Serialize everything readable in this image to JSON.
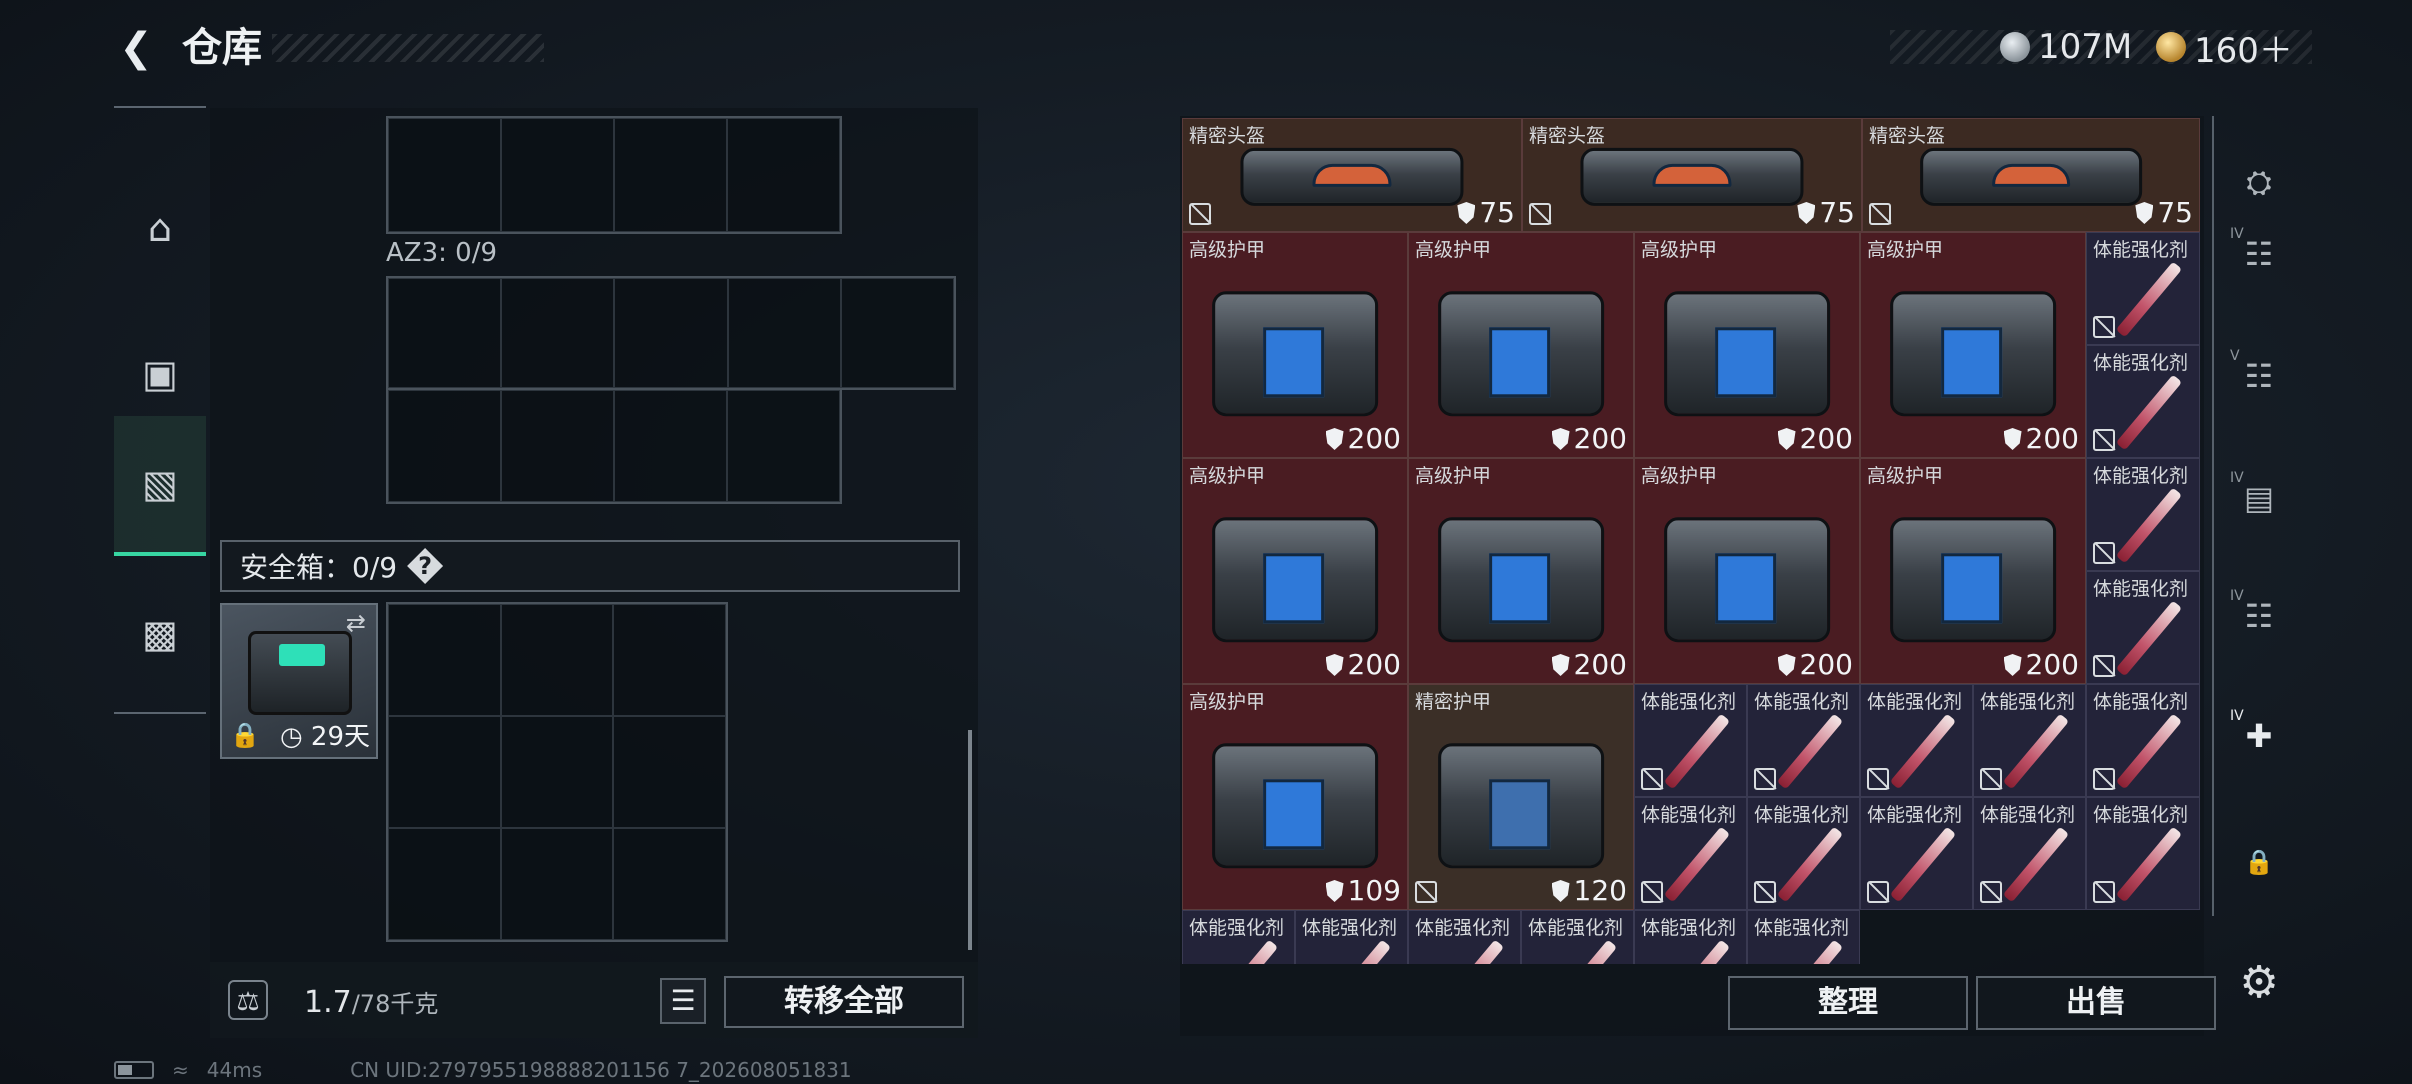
{
  "header": {
    "title": "仓库",
    "back_icon": "chevron-left-icon"
  },
  "currency": [
    {
      "icon": "silver-coin-icon",
      "value": "107M"
    },
    {
      "icon": "gold-coin-icon",
      "value": "160＋"
    }
  ],
  "left_nav": {
    "items": [
      {
        "name": "weapon",
        "icon": "pistol-icon",
        "active": false
      },
      {
        "name": "gear",
        "icon": "vest-icon",
        "active": false
      },
      {
        "name": "backpack",
        "icon": "backpack-icon",
        "active": true
      },
      {
        "name": "case",
        "icon": "briefcase-icon",
        "active": false
      }
    ]
  },
  "left_panel": {
    "az3_label": "AZ3: 0/9",
    "safebox": {
      "label": "安全箱：0/9",
      "help": "?",
      "days": "29天"
    },
    "weight": {
      "current": "1.7",
      "max": "/78千克"
    },
    "transfer_all": "转移全部"
  },
  "items": {
    "helmet": {
      "name": "精密头盔",
      "value": "75"
    },
    "armor": {
      "name": "高级护甲",
      "value": "200"
    },
    "armor_damaged": {
      "name": "高级护甲",
      "value": "109"
    },
    "precision_armor": {
      "name": "精密护甲",
      "value": "120"
    },
    "buff": {
      "name": "体能强化剂"
    }
  },
  "buttons": {
    "organize": "整理",
    "sell": "出售"
  },
  "right_nav": {
    "items": [
      {
        "icon": "helmet-slot-icon",
        "level": ""
      },
      {
        "icon": "armor-slot-icon",
        "level": "IV"
      },
      {
        "icon": "armor-slot-icon",
        "level": "V"
      },
      {
        "icon": "storage-slot-icon",
        "level": "IV"
      },
      {
        "icon": "armor-slot-icon",
        "level": "IV"
      },
      {
        "icon": "medkit-slot-icon",
        "level": "IV"
      },
      {
        "icon": "lock-icon",
        "level": ""
      }
    ]
  },
  "status": {
    "ping": "44ms",
    "uid": "CN UID:2797955198888201156 7_202608051831"
  }
}
